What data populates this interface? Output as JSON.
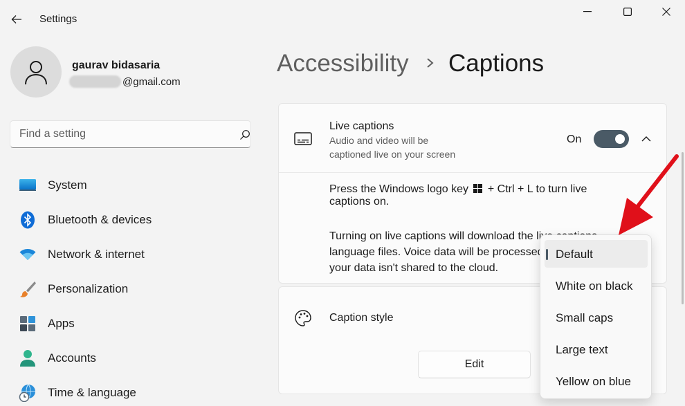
{
  "window": {
    "title": "Settings"
  },
  "profile": {
    "name": "gaurav bidasaria",
    "email_visible": "@gmail.com"
  },
  "search": {
    "placeholder": "Find a setting"
  },
  "nav": {
    "items": [
      {
        "label": "System",
        "icon": "monitor-icon"
      },
      {
        "label": "Bluetooth & devices",
        "icon": "bluetooth-icon"
      },
      {
        "label": "Network & internet",
        "icon": "wifi-icon"
      },
      {
        "label": "Personalization",
        "icon": "brush-icon"
      },
      {
        "label": "Apps",
        "icon": "apps-icon"
      },
      {
        "label": "Accounts",
        "icon": "account-icon"
      },
      {
        "label": "Time & language",
        "icon": "globe-clock-icon"
      }
    ]
  },
  "breadcrumb": {
    "parent": "Accessibility",
    "current": "Captions"
  },
  "live_captions": {
    "title": "Live captions",
    "desc_line1": "Audio and video will be",
    "desc_line2": "captioned live on your screen",
    "toggle_label": "On",
    "info_line1_a": "Press the Windows logo key",
    "info_line1_b": "+ Ctrl + L to turn live",
    "info_line1_c": "captions on.",
    "info_line2_a": "Turning on live captions will download the live captions",
    "info_line2_b": "language files. Voice data will be processed locally and",
    "info_line2_c": "your data isn't shared to the cloud."
  },
  "caption_style": {
    "title": "Caption style",
    "edit_label": "Edit"
  },
  "style_menu": {
    "options": [
      "Default",
      "White on black",
      "Small caps",
      "Large text",
      "Yellow on blue"
    ],
    "selected": "Default"
  },
  "colors": {
    "accent": "#4a5a66",
    "annotation_arrow": "#e0101a"
  }
}
